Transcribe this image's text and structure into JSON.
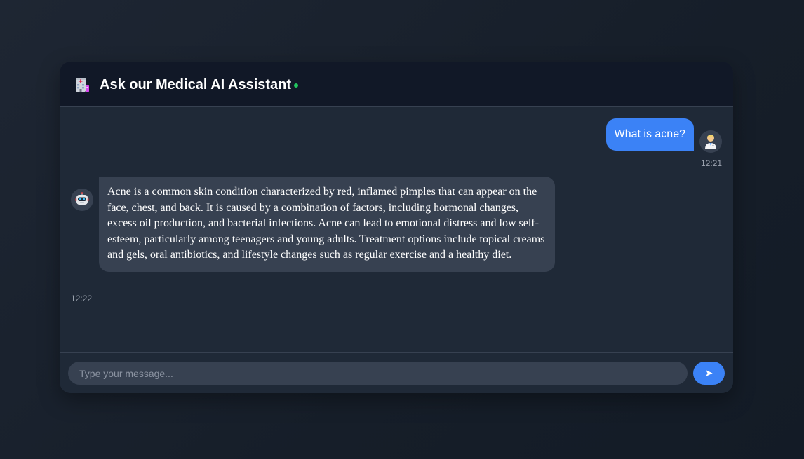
{
  "header": {
    "title": "Ask our Medical AI Assistant",
    "icon": "hospital-icon",
    "status_color": "#22c55e"
  },
  "messages": [
    {
      "sender": "user",
      "avatar": "doctor-icon",
      "text": "What is acne?",
      "time": "12:21"
    },
    {
      "sender": "bot",
      "avatar": "robot-icon",
      "text": "Acne is a common skin condition characterized by red, inflamed pimples that can appear on the face, chest, and back. It is caused by a combination of factors, including hormonal changes, excess oil production, and bacterial infections. Acne can lead to emotional distress and low self-esteem, particularly among teenagers and young adults. Treatment options include topical creams and gels, oral antibiotics, and lifestyle changes such as regular exercise and a healthy diet.",
      "time": "12:22"
    }
  ],
  "input": {
    "placeholder": "Type your message...",
    "value": ""
  },
  "send_button": {
    "label": "➤",
    "icon": "send-icon"
  },
  "colors": {
    "accent": "#3b82f6",
    "panel": "#1f2937",
    "header": "#111827",
    "bubble_bot": "#374151"
  }
}
